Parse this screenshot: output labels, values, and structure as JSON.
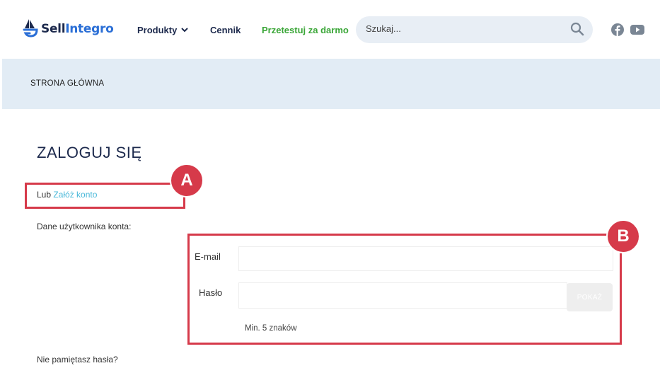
{
  "header": {
    "logo": {
      "part1": "Sell",
      "part2": "Integro"
    },
    "nav": {
      "products": "Produkty",
      "pricing": "Cennik",
      "trial": "Przetestuj za darmo"
    },
    "search": {
      "placeholder": "Szukaj..."
    },
    "social": [
      "facebook-icon",
      "youtube-icon"
    ]
  },
  "breadcrumb": "STRONA GŁÓWNA",
  "main": {
    "title": "ZALOGUJ SIĘ",
    "create_prefix": "Lub",
    "create_link": "Załóż konto",
    "account_label": "Dane użytkownika konta:",
    "email_label": "E-mail",
    "email_value": "",
    "password_label": "Hasło",
    "password_value": "",
    "show_button": "POKAŻ",
    "password_hint": "Min. 5 znaków",
    "forgot": "Nie pamiętasz hasła?"
  },
  "annotations": {
    "a": "A",
    "b": "B"
  },
  "colors": {
    "accent_red": "#d63a4a",
    "brand_navy": "#1d2a4d",
    "brand_blue": "#2b6fd6",
    "trial_green": "#3aa637",
    "link_blue": "#49b8d9",
    "band_bg": "#e2ecf5"
  }
}
